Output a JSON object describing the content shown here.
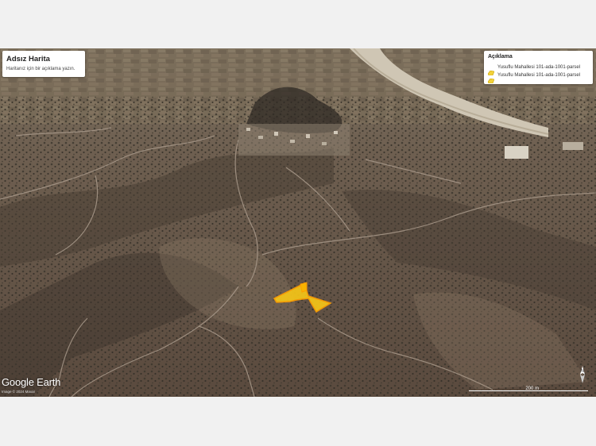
{
  "map": {
    "title": "Adsız Harita",
    "description": "Haritanız için bir açıklama yazın.",
    "legend": {
      "heading": "Açıklama",
      "items": [
        {
          "label": "Yusuflu Mahallesi 101-ada-1001-parsel",
          "color": "#f2d13a"
        },
        {
          "label": "Yusuflu Mahallesi 101-ada-1001-parsel",
          "color": "#f2d13a"
        }
      ]
    },
    "parcel_fill": "#f5c518",
    "parcel_stroke": "#ff9d00",
    "attribution": {
      "logo": "Google Earth",
      "credit": "Image © 2024 Maxar"
    },
    "scale_label": "200 m",
    "compass": "compass-icon"
  }
}
